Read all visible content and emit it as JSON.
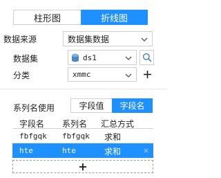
{
  "chart_type": {
    "tabs": [
      {
        "label": "柱形图",
        "active": false
      },
      {
        "label": "折线图",
        "active": true
      }
    ]
  },
  "data_source": {
    "label": "数据来源",
    "value": "数据集数据"
  },
  "dataset": {
    "label": "数据集",
    "value": "ds1"
  },
  "category": {
    "label": "分类",
    "value": "xmmc"
  },
  "series_name": {
    "label": "系列名使用",
    "options": [
      {
        "label": "字段值",
        "active": false
      },
      {
        "label": "字段名",
        "active": true
      }
    ]
  },
  "table": {
    "headers": [
      "字段名",
      "系列名",
      "汇总方式"
    ],
    "rows": [
      {
        "field": "fbfgqk",
        "series": "fbfgqk",
        "summary": "求和",
        "selected": false
      },
      {
        "field": "hte",
        "series": "hte",
        "summary": "求和",
        "selected": true
      }
    ],
    "add_label": "+"
  },
  "colors": {
    "accent": "#1e90ff",
    "border": "#cfcfcf"
  }
}
